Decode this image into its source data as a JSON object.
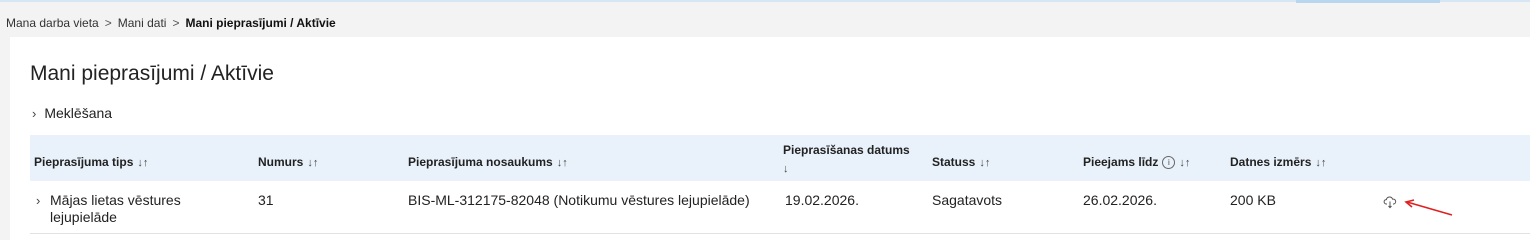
{
  "breadcrumb": {
    "items": [
      "Mana darba vieta",
      "Mani dati"
    ],
    "current": "Mani pieprasījumi / Aktīvie",
    "separator": ">"
  },
  "page": {
    "title": "Mani pieprasījumi / Aktīvie",
    "search_toggle": "Meklēšana"
  },
  "table": {
    "headers": {
      "type": "Pieprasījuma tips",
      "number": "Numurs",
      "name": "Pieprasījuma nosaukums",
      "request_date": "Pieprasīšanas datums",
      "status": "Statuss",
      "available_until": "Pieejams līdz",
      "file_size": "Datnes izmērs"
    },
    "sort_glyph": "↓↑",
    "sort_glyph_active": "↓",
    "info_glyph": "i",
    "rows": [
      {
        "type_line1": "Mājas lietas vēstures",
        "type_line2": "lejupielāde",
        "number": "31",
        "name": "BIS-ML-312175-82048 (Notikumu vēstures lejupielāde)",
        "request_date": "19.02.2026.",
        "status": "Sagatavots",
        "available_until": "26.02.2026.",
        "file_size": "200 KB"
      }
    ]
  },
  "colors": {
    "header_bg": "#e9f2fb",
    "annotation_arrow": "#e02020"
  },
  "icons": {
    "download": "cloud-download-icon",
    "expand": "chevron-right-icon",
    "info": "info-circle-icon"
  }
}
